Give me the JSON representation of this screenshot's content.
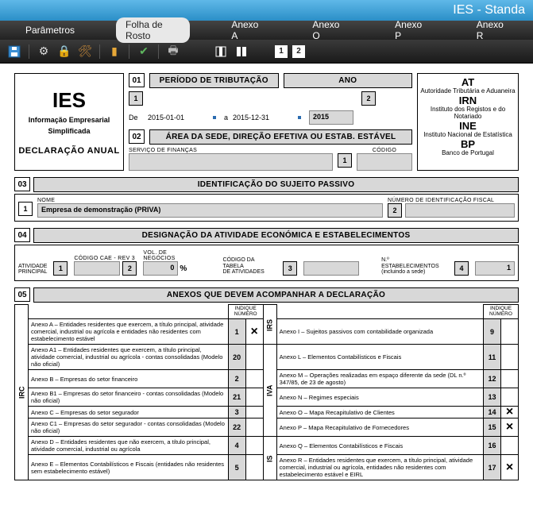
{
  "window": {
    "title": "IES - Standa"
  },
  "menu": {
    "parametros": "Parâmetros",
    "folha": "Folha de Rosto",
    "anexoA": "Anexo A",
    "anexoO": "Anexo O",
    "anexoP": "Anexo P",
    "anexoR": "Anexo R"
  },
  "toolbar": {
    "page1": "1",
    "page2": "2"
  },
  "header": {
    "ies": "IES",
    "sub1": "Informação Empresarial",
    "sub2": "Simplificada",
    "decl": "DECLARAÇÃO  ANUAL",
    "s01": "01",
    "periodo_title": "PERÍODO DE TRIBUTAÇÃO",
    "ano_title": "ANO",
    "n1": "1",
    "n2": "2",
    "de": "De",
    "a": "a",
    "date_from": "2015-01-01",
    "date_to": "2015-12-31",
    "ano": "2015",
    "s02": "02",
    "area_title": "ÁREA DA SEDE, DIREÇÃO EFETIVA OU ESTAB. ESTÁVEL",
    "servico": "SERVIÇO DE FINANÇAS",
    "codigo": "CÓDIGO",
    "at": "AT",
    "at_sub": "Autoridade Tributária e Aduaneira",
    "irn": "IRN",
    "irn_sub": "Instituto dos Registos e do Notariado",
    "ine": "INE",
    "ine_sub": "Instituto Nacional de Estatística",
    "bp": "BP",
    "bp_sub": "Banco de Portugal"
  },
  "s03": {
    "num": "03",
    "title": "IDENTIFICAÇÃO DO SUJEITO PASSIVO",
    "n1": "1",
    "nome_lbl": "NOME",
    "nome": "Empresa de demonstração (PRIVA)",
    "nif_lbl": "NÚMERO DE IDENTIFICAÇÃO FISCAL",
    "n2": "2"
  },
  "s04": {
    "num": "04",
    "title": "DESIGNAÇÃO DA ATIVIDADE ECONÓMICA E ESTABELECIMENTOS",
    "ativ_lbl1": "ATIVIDADE",
    "ativ_lbl2": "PRINCIPAL",
    "cae_lbl": "CÓDIGO CAE - REV 3",
    "vol_lbl": "VOL. DE NEGÓCIOS",
    "n1": "1",
    "n2": "2",
    "vol_val": "0",
    "pct": "%",
    "tabela_lbl1": "CÓDIGO DA TABELA",
    "tabela_lbl2": "DE ATIVIDADES",
    "n3": "3",
    "estab_lbl1": "N.º ESTABELECIMENTOS",
    "estab_lbl2": "(incluindo a sede)",
    "n4": "4",
    "estab_val": "1"
  },
  "s05": {
    "num": "05",
    "title": "ANEXOS QUE DEVEM ACOMPANHAR A DECLARAÇÃO",
    "col_head": "INDIQUE NÚMERO",
    "irc": "IRC",
    "irs": "IRS",
    "iva": "IVA",
    "is": "IS",
    "rows_left": [
      {
        "txt": "Anexo A – Entidades residentes que exercem, a título principal, atividade comercial, industrial ou agrícola e entidades não residentes com estabelecimento estável",
        "num": "1",
        "chk": "×"
      },
      {
        "txt": "Anexo A1 – Entidades residentes que exercem, a título principal, atividade comercial, industrial ou agrícola - contas consolidadas (Modelo não oficial)",
        "num": "20",
        "chk": ""
      },
      {
        "txt": "Anexo B – Empresas do setor financeiro",
        "num": "2",
        "chk": ""
      },
      {
        "txt": "Anexo B1 –  Empresas do setor financeiro -  contas consolidadas  (Modelo não oficial)",
        "num": "21",
        "chk": ""
      },
      {
        "txt": "Anexo C – Empresas do setor segurador",
        "num": "3",
        "chk": ""
      },
      {
        "txt": "Anexo C1 – Empresas do setor segurador - contas consolidadas  (Modelo não oficial)",
        "num": "22",
        "chk": ""
      },
      {
        "txt": "Anexo D –  Entidades residentes que não exercem,  a título principal,  atividade comercial,  industrial  ou agrícola",
        "num": "4",
        "chk": ""
      },
      {
        "txt": "Anexo E – Elementos Contabilísticos e Fiscais (entidades não residentes sem estabelecimento estável)",
        "num": "5",
        "chk": ""
      }
    ],
    "rows_right": [
      {
        "txt": "Anexo I – Sujeitos passivos com contabilidade organizada",
        "num": "9",
        "chk": ""
      },
      {
        "txt": "Anexo L – Elementos Contabilísticos e Fiscais",
        "num": "11",
        "chk": ""
      },
      {
        "txt": "Anexo M – Operações realizadas em espaço diferente da sede (DL n.º  347/85,  de 23 de agosto)",
        "num": "12",
        "chk": ""
      },
      {
        "txt": "Anexo N – Regimes especiais",
        "num": "13",
        "chk": ""
      },
      {
        "txt": "Anexo O – Mapa Recapitulativo de Clientes",
        "num": "14",
        "chk": "×"
      },
      {
        "txt": "Anexo P –  Mapa Recapitulativo de Fornecedores",
        "num": "15",
        "chk": "×"
      },
      {
        "txt": "Anexo Q – Elementos Contabilísticos e Fiscais",
        "num": "16",
        "chk": ""
      },
      {
        "txt": "Anexo R –  Entidades residentes que exercem,  a título principal, atividade comercial, industrial ou agrícola, entidades não residentes com  estabelecimento estável e  EIRL",
        "num": "17",
        "chk": "×"
      }
    ]
  }
}
